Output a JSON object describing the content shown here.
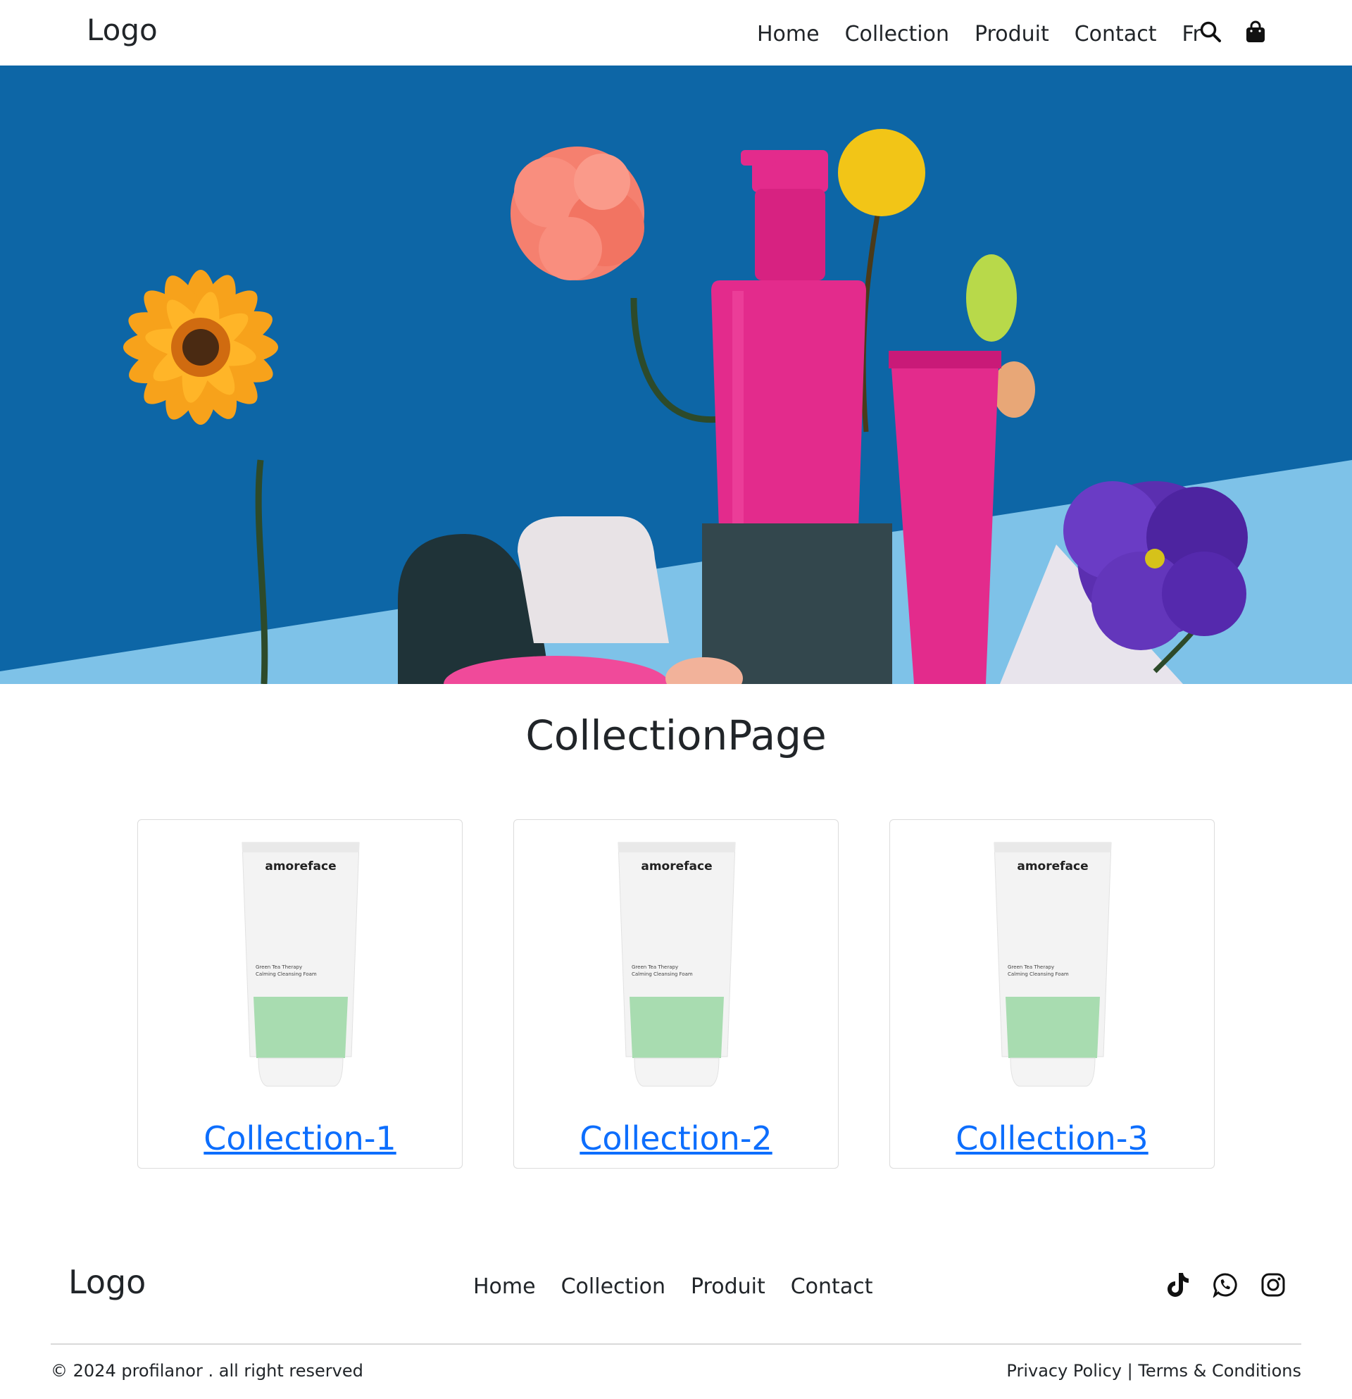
{
  "header": {
    "logo": "Logo",
    "nav": [
      {
        "label": "Home"
      },
      {
        "label": "Collection"
      },
      {
        "label": "Produit"
      },
      {
        "label": "Contact"
      },
      {
        "label": "Fr"
      }
    ],
    "icons": [
      "search-icon",
      "shopping-bag-icon"
    ]
  },
  "page": {
    "title": "CollectionPage"
  },
  "collections": [
    {
      "label": "Collection-1",
      "product_brand": "amoreface",
      "product_line1": "Green Tea Therapy",
      "product_line2": "Calming Cleansing Foam"
    },
    {
      "label": "Collection-2",
      "product_brand": "amoreface",
      "product_line1": "Green Tea Therapy",
      "product_line2": "Calming Cleansing Foam"
    },
    {
      "label": "Collection-3",
      "product_brand": "amoreface",
      "product_line1": "Green Tea Therapy",
      "product_line2": "Calming Cleansing Foam"
    }
  ],
  "footer": {
    "logo": "Logo",
    "nav": [
      {
        "label": "Home"
      },
      {
        "label": "Collection"
      },
      {
        "label": "Produit"
      },
      {
        "label": "Contact"
      }
    ],
    "social": [
      "tiktok-icon",
      "whatsapp-icon",
      "instagram-icon"
    ],
    "copyright": "© 2024 profilanor . all right reserved",
    "privacy": "Privacy Policy",
    "separator": " | ",
    "terms": "Terms & Conditions"
  },
  "colors": {
    "link": "#0d6efd",
    "text": "#212529",
    "hero_bg": "#0d66a6",
    "hero_floor": "#7ec2e8",
    "bottle_pink": "#e32b8c",
    "tube_green": "#a8dcb0"
  }
}
